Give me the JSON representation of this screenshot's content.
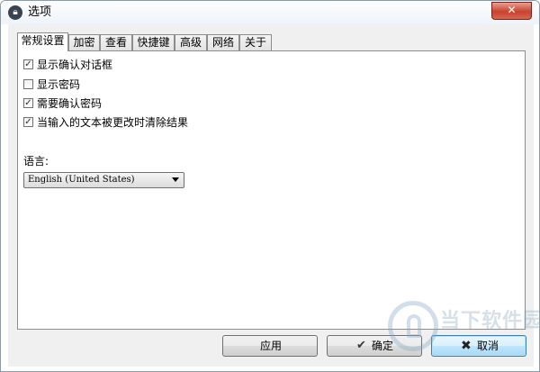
{
  "window": {
    "title": "选项",
    "app_icon": "lock-icon",
    "close_label": "✕"
  },
  "tabs": [
    {
      "label": "常规设置",
      "active": true
    },
    {
      "label": "加密",
      "active": false
    },
    {
      "label": "查看",
      "active": false
    },
    {
      "label": "快捷键",
      "active": false
    },
    {
      "label": "高级",
      "active": false
    },
    {
      "label": "网络",
      "active": false
    },
    {
      "label": "关于",
      "active": false
    }
  ],
  "general": {
    "options": [
      {
        "label": "显示确认对话框",
        "checked": true
      },
      {
        "label": "显示密码",
        "checked": false
      },
      {
        "label": "需要确认密码",
        "checked": true
      },
      {
        "label": "当输入的文本被更改时清除结果",
        "checked": true
      }
    ],
    "language_label": "语言:",
    "language_value": "English (United States)"
  },
  "buttons": {
    "apply": "应用",
    "ok": "确定",
    "cancel": "取消"
  },
  "watermark": {
    "text": "当下软件园"
  }
}
